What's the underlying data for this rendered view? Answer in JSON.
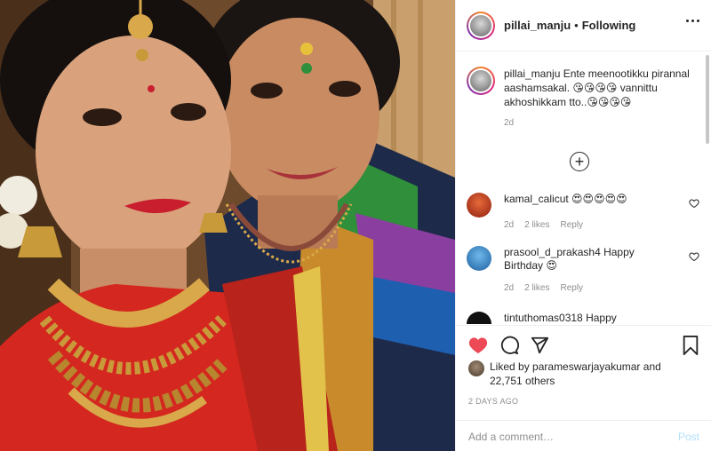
{
  "header": {
    "username": "pillai_manju",
    "separator": "•",
    "follow_status": "Following"
  },
  "caption": {
    "username": "pillai_manju",
    "text": "Ente meenootikku pirannal aashamsakal. 😘😘😘😘 vannittu akhoshikkam tto..😘😘😘😘",
    "time": "2d"
  },
  "comments": [
    {
      "username": "kamal_calicut",
      "text": "😍😍😍😍😍",
      "time": "2d",
      "likes": "2 likes",
      "reply": "Reply",
      "avatar_color": "#c0392b"
    },
    {
      "username": "prasool_d_prakash4",
      "text": "Happy Birthday 😍",
      "time": "2d",
      "likes": "2 likes",
      "reply": "Reply",
      "avatar_color": "#3b8fd4"
    },
    {
      "username": "tintuthomas0318",
      "text": "Happy",
      "avatar_color": "#111111"
    }
  ],
  "likes": {
    "prefix": "Liked by",
    "user": "parameswarjayakumar",
    "connector": "and",
    "count": "22,751 others"
  },
  "date": "2 DAYS AGO",
  "add_comment": {
    "placeholder": "Add a comment…",
    "post_label": "Post"
  },
  "colors": {
    "like_red": "#ed4956",
    "text_primary": "#262626",
    "text_secondary": "#8e8e8e",
    "post_disabled": "#b2dffc"
  },
  "icons": [
    "heart-icon",
    "comment-icon",
    "share-icon",
    "bookmark-icon",
    "more-icon",
    "add-circle-icon",
    "heart-outline-icon"
  ]
}
